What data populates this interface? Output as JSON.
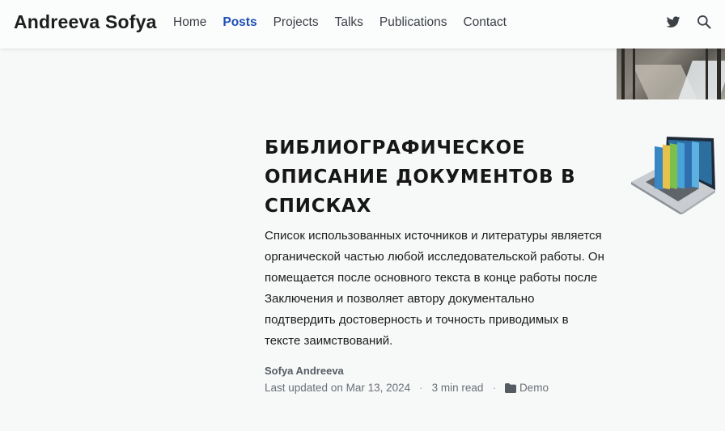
{
  "navbar": {
    "brand": "Andreeva Sofya",
    "links": [
      {
        "label": "Home",
        "active": false
      },
      {
        "label": "Posts",
        "active": true
      },
      {
        "label": "Projects",
        "active": false
      },
      {
        "label": "Talks",
        "active": false
      },
      {
        "label": "Publications",
        "active": false
      },
      {
        "label": "Contact",
        "active": false
      }
    ],
    "icons": [
      "twitter-icon",
      "search-icon"
    ]
  },
  "post": {
    "title": "БИБЛИОГРАФИЧЕСКОЕ ОПИСАНИЕ ДОКУМЕНТОВ В СПИСКАХ",
    "summary": "Список использованных источников и литературы является органической частью любой исследовательской работы. Он помещается после основного текста в конце работы после Заключения и позволяет автору документально подтвердить достоверность и точность приводимых в тексте заимствований.",
    "author": "Sofya Andreeva",
    "updated": "Last updated on Mar 13, 2024",
    "read_time": "3 min read",
    "separator": "·",
    "category": "Demo"
  },
  "colors": {
    "active_link": "#1f4fb5",
    "background": "#f7f8f8"
  }
}
